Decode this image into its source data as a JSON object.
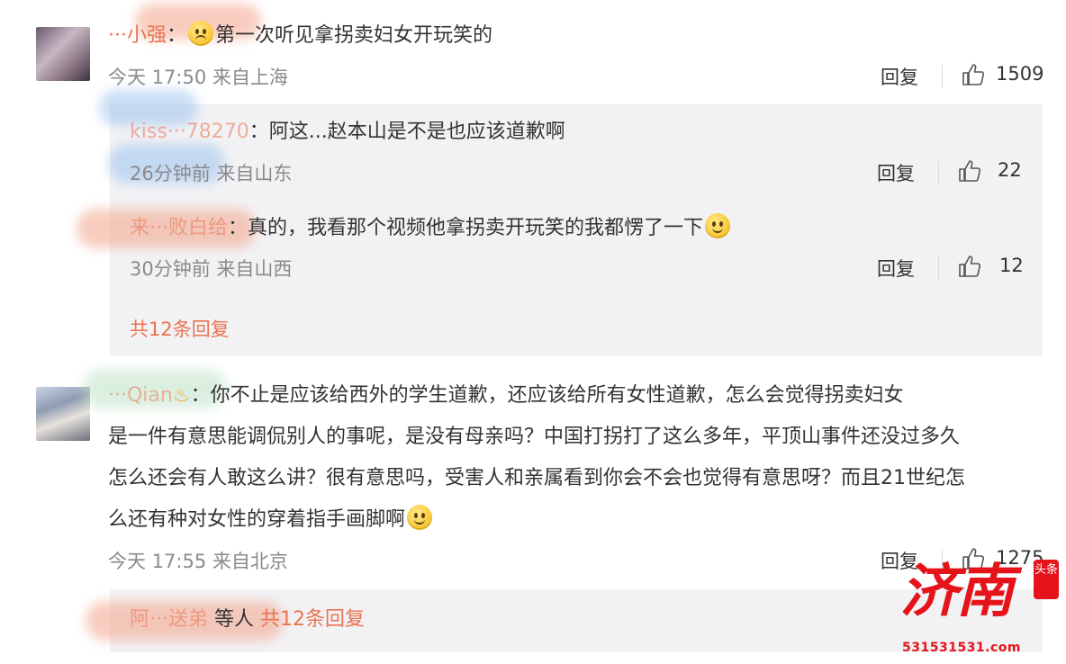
{
  "comments": [
    {
      "username": "···小强",
      "text": "第一次听见拿拐卖妇女开玩笑的",
      "time": "今天 17:50",
      "location": "来自上海",
      "reply_label": "回复",
      "likes": "1509",
      "replies": [
        {
          "username": "kiss···78270",
          "text": "阿这...赵本山是不是也应该道歉啊",
          "time": "26分钟前",
          "location": "来自山东",
          "reply_label": "回复",
          "likes": "22"
        },
        {
          "username": "来···败白给",
          "text": "真的，我看那个视频他拿拐卖开玩笑的我都愣了一下",
          "time": "30分钟前",
          "location": "来自山西",
          "reply_label": "回复",
          "likes": "12"
        }
      ],
      "more_replies": "共12条回复"
    },
    {
      "username": "···Qian",
      "text_lines": [
        "你不止是应该给西外的学生道歉，还应该给所有女性道歉，怎么会觉得拐卖妇女",
        "是一件有意思能调侃别人的事呢，是没有母亲吗？中国打拐打了这么多年，平顶山事件还没过多久",
        "怎么还会有人敢这么讲？很有意思吗，受害人和亲属看到你会不会也觉得有意思呀？而且21世纪怎",
        "么还有种对女性的穿着指手画脚啊"
      ],
      "time": "今天 17:55",
      "location": "来自北京",
      "reply_label": "回复",
      "likes": "1275",
      "reply_summary": {
        "names": "阿···送弟",
        "suffix": "等人",
        "more_replies": "共12条回复"
      }
    }
  ],
  "watermark": {
    "logo": "济南",
    "badge": "头条",
    "url": "531531531.com",
    "color": "#e5141b"
  },
  "colors": {
    "accent": "#eb7350",
    "meta_gray": "#8a8a8a",
    "reply_bg": "#f2f2f5"
  }
}
